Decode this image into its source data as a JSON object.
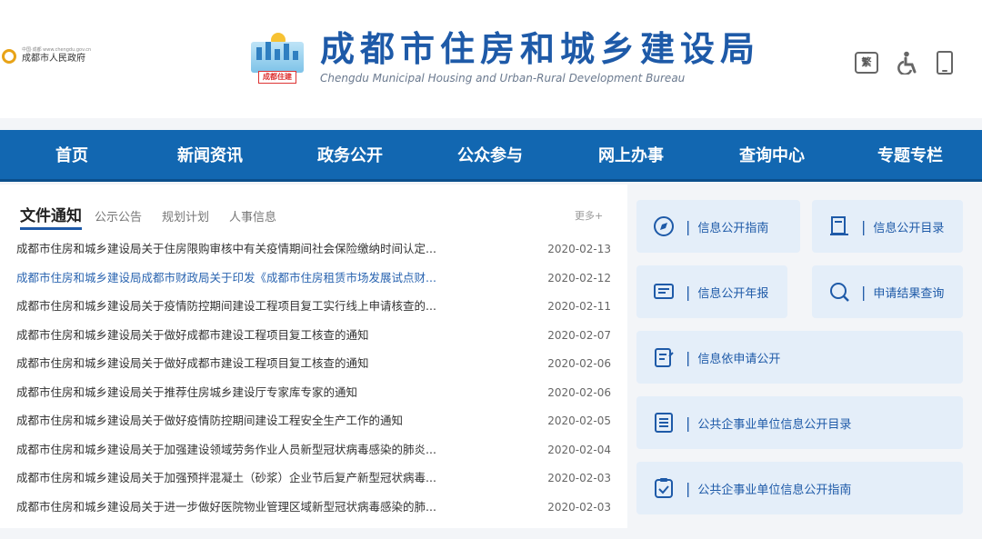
{
  "header": {
    "gov_small": "中国·成都 www.chengdu.gov.cn",
    "gov_name": "成都市人民政府",
    "logo_tag": "成都住建",
    "title_cn": "成都市住房和城乡建设局",
    "title_en": "Chengdu Municipal Housing and Urban-Rural Development Bureau",
    "trad_label": "繁"
  },
  "nav": [
    {
      "label": "首页"
    },
    {
      "label": "新闻资讯"
    },
    {
      "label": "政务公开"
    },
    {
      "label": "公众参与"
    },
    {
      "label": "网上办事"
    },
    {
      "label": "查询中心"
    },
    {
      "label": "专题专栏"
    }
  ],
  "tabs": {
    "active": "文件通知",
    "items": [
      "公示公告",
      "规划计划",
      "人事信息"
    ],
    "more": "更多+"
  },
  "news": [
    {
      "title": "成都市住房和城乡建设局关于住房限购审核中有关疫情期间社会保险缴纳时间认定...",
      "date": "2020-02-13"
    },
    {
      "title": "成都市住房和城乡建设局成都市财政局关于印发《成都市住房租赁市场发展试点财...",
      "date": "2020-02-12"
    },
    {
      "title": "成都市住房和城乡建设局关于疫情防控期间建设工程项目复工实行线上申请核查的...",
      "date": "2020-02-11"
    },
    {
      "title": "成都市住房和城乡建设局关于做好成都市建设工程项目复工核查的通知",
      "date": "2020-02-07"
    },
    {
      "title": "成都市住房和城乡建设局关于做好成都市建设工程项目复工核查的通知",
      "date": "2020-02-06"
    },
    {
      "title": "成都市住房和城乡建设局关于推荐住房城乡建设厅专家库专家的通知",
      "date": "2020-02-06"
    },
    {
      "title": "成都市住房和城乡建设局关于做好疫情防控期间建设工程安全生产工作的通知",
      "date": "2020-02-05"
    },
    {
      "title": "成都市住房和城乡建设局关于加强建设领域劳务作业人员新型冠状病毒感染的肺炎...",
      "date": "2020-02-04"
    },
    {
      "title": "成都市住房和城乡建设局关于加强预拌混凝土（砂浆）企业节后复产新型冠状病毒...",
      "date": "2020-02-03"
    },
    {
      "title": "成都市住房和城乡建设局关于进一步做好医院物业管理区域新型冠状病毒感染的肺...",
      "date": "2020-02-03"
    }
  ],
  "quick": {
    "guide": "信息公开指南",
    "catalog": "信息公开目录",
    "annual": "信息公开年报",
    "query": "申请结果查询",
    "apply": "信息依申请公开",
    "enterprise_catalog": "公共企事业单位信息公开目录",
    "enterprise_guide": "公共企事业单位信息公开指南"
  },
  "colors": {
    "brand": "#1267b1",
    "title": "#1e5aa8",
    "button_bg": "#e4eef9"
  }
}
